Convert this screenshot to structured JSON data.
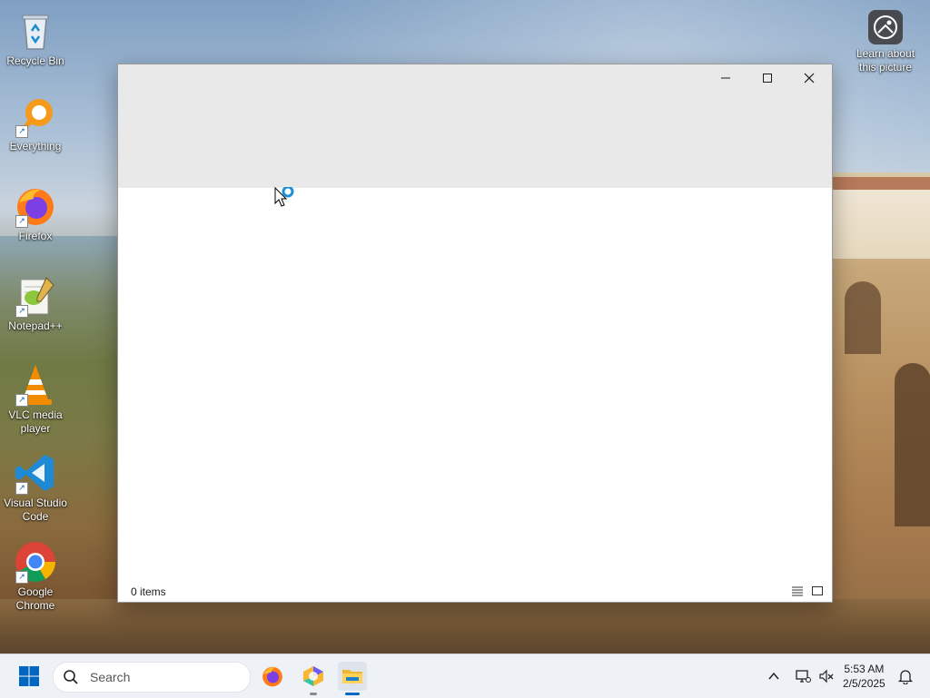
{
  "desktop": {
    "icons": [
      {
        "label": "Recycle Bin"
      },
      {
        "label": "Everything"
      },
      {
        "label": "Firefox"
      },
      {
        "label": "Notepad++"
      },
      {
        "label": "VLC media player"
      },
      {
        "label": "Visual Studio Code"
      },
      {
        "label": "Google Chrome"
      }
    ],
    "learn_about": "Learn about this picture"
  },
  "window": {
    "status_text": "0 items",
    "controls": {
      "minimize": "—",
      "maximize": "☐",
      "close": "✕"
    }
  },
  "taskbar": {
    "search_placeholder": "Search",
    "time": "5:53 AM",
    "date": "2/5/2025"
  },
  "colors": {
    "accent": "#0067c0",
    "titlebar": "#e9e9e9",
    "taskbar": "#eef1f6"
  }
}
